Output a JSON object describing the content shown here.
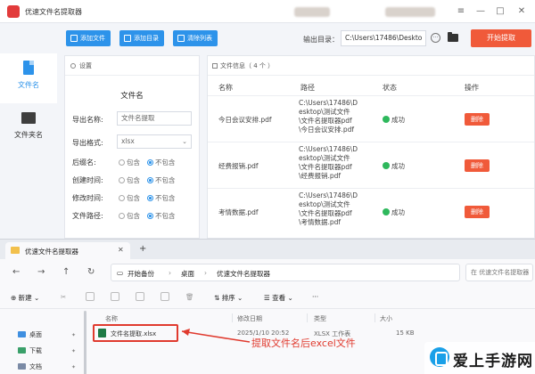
{
  "app": {
    "title": "优速文件名提取器",
    "toolbar": {
      "add_file": "添加文件",
      "add_dir": "添加目录",
      "clear_list": "清除列表",
      "output_label": "输出目录：",
      "output_path": "C:\\Users\\17486\\Deskto",
      "more": "···",
      "start": "开始提取"
    },
    "sidebar": [
      {
        "label": "文件名",
        "icon": "file-icon",
        "active": true
      },
      {
        "label": "文件夹名",
        "icon": "folder-icon",
        "active": false
      }
    ],
    "settings": {
      "header": "设置",
      "title": "文件名",
      "export_name_label": "导出名称:",
      "export_name_placeholder": "文件名提取",
      "export_format_label": "导出格式:",
      "export_format_value": "xlsx",
      "rows": [
        {
          "label": "后缀名:",
          "include": "包含",
          "exclude": "不包含",
          "selected": "exclude"
        },
        {
          "label": "创建时间:",
          "include": "包含",
          "exclude": "不包含",
          "selected": "exclude"
        },
        {
          "label": "修改时间:",
          "include": "包含",
          "exclude": "不包含",
          "selected": "exclude"
        },
        {
          "label": "文件路径:",
          "include": "包含",
          "exclude": "不包含",
          "selected": "exclude"
        }
      ]
    },
    "file_info": {
      "header": "文件信息（ 4 个 ）",
      "columns": [
        "名称",
        "路径",
        "状态",
        "操作"
      ],
      "rows": [
        {
          "name": "今日会议安排.pdf",
          "path": [
            "C:\\Users\\17486\\D",
            "esktop\\测试文件",
            "\\文件名提取器pdf",
            "\\今日会议安排.pdf"
          ],
          "status": "成功",
          "action": "删除"
        },
        {
          "name": "经费报销.pdf",
          "path": [
            "C:\\Users\\17486\\D",
            "esktop\\测试文件",
            "\\文件名提取器pdf",
            "\\经费报销.pdf"
          ],
          "status": "成功",
          "action": "删除"
        },
        {
          "name": "考情数据.pdf",
          "path": [
            "C:\\Users\\17486\\D",
            "esktop\\测试文件",
            "\\文件名提取器pdf",
            "\\考情数据.pdf"
          ],
          "status": "成功",
          "action": "删除"
        }
      ]
    }
  },
  "explorer": {
    "tab_title": "优速文件名提取器",
    "breadcrumbs": [
      "开始备份",
      "桌面",
      "优速文件名提取器"
    ],
    "search_placeholder": "在 优速文件名提取器",
    "cmd": {
      "new": "新建",
      "sort": "排序",
      "view": "查看",
      "more": "···"
    },
    "columns": [
      "名称",
      "修改日期",
      "类型",
      "大小"
    ],
    "file": {
      "name": "文件名提取.xlsx",
      "modified": "2025/1/10 20:52",
      "type": "XLSX 工作表",
      "size": "15 KB"
    },
    "side": [
      {
        "label": "桌面",
        "icon_color": "#3f8fe0"
      },
      {
        "label": "下载",
        "icon_color": "#3aa06a"
      },
      {
        "label": "文档",
        "icon_color": "#7a8aa5"
      }
    ]
  },
  "annotation": "提取文件名后excel文件",
  "watermark": "爱上手游网",
  "colors": {
    "accent": "#2d93ea",
    "danger": "#f05a3a",
    "success": "#2eb85c",
    "annotation": "#e03a2e"
  }
}
